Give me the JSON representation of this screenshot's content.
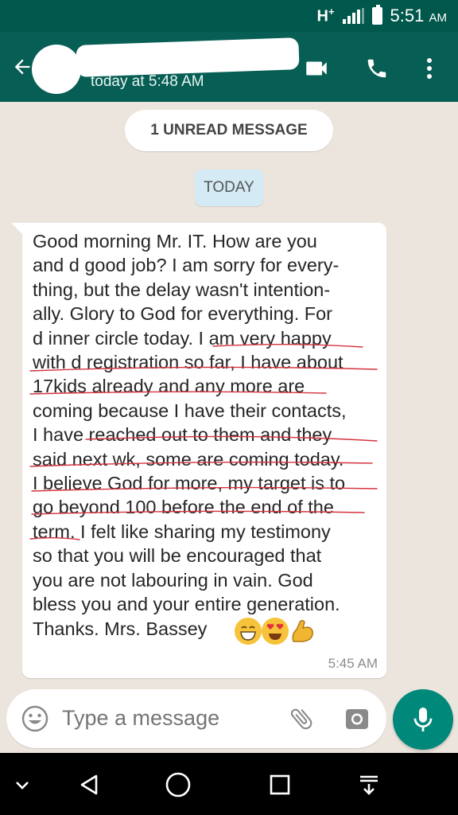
{
  "status_bar": {
    "network": "H",
    "network_plus": "+",
    "time": "5:51",
    "am_pm": "AM"
  },
  "app_bar": {
    "last_seen": "today at 5:48 AM",
    "icons": [
      "back-arrow-icon",
      "avatar",
      "video-call-icon",
      "phone-call-icon",
      "more-vert-icon"
    ]
  },
  "chat": {
    "unread_banner": "1 UNREAD MESSAGE",
    "date_chip": "TODAY",
    "message": {
      "text": "Good morning Mr. IT. How are you\nand d good job? I am sorry for every-\nthing, but the delay wasn't intention-\nally. Glory to God for everything. For\nd inner circle today. I am very happy\nwith d registration so far, I have about\n17kids already and any more are\ncoming because I have their contacts,\nI have reached out to them and they\nsaid next wk, some are coming today.\nI believe God for more, my target is to\ngo beyond 100 before the end of the\nterm. I felt like sharing my testimony\nso that you will be encouraged that\nyou are not labouring in vain. God\nbless you and your entire generation.\nThanks. Mrs. Bassey",
      "emojis": [
        "😁",
        "😍",
        "💪"
      ],
      "time": "5:45 AM"
    }
  },
  "composer": {
    "placeholder": "Type a message"
  },
  "nav_bar": {
    "icons": [
      "chevron-down-icon",
      "back-triangle-icon",
      "home-circle-icon",
      "recents-square-icon",
      "notification-pull-icon"
    ]
  },
  "colors": {
    "app_bar": "#075e54",
    "status_bar": "#00574b",
    "mic_button": "#00897b",
    "annotation_ink": "#d5333f"
  }
}
